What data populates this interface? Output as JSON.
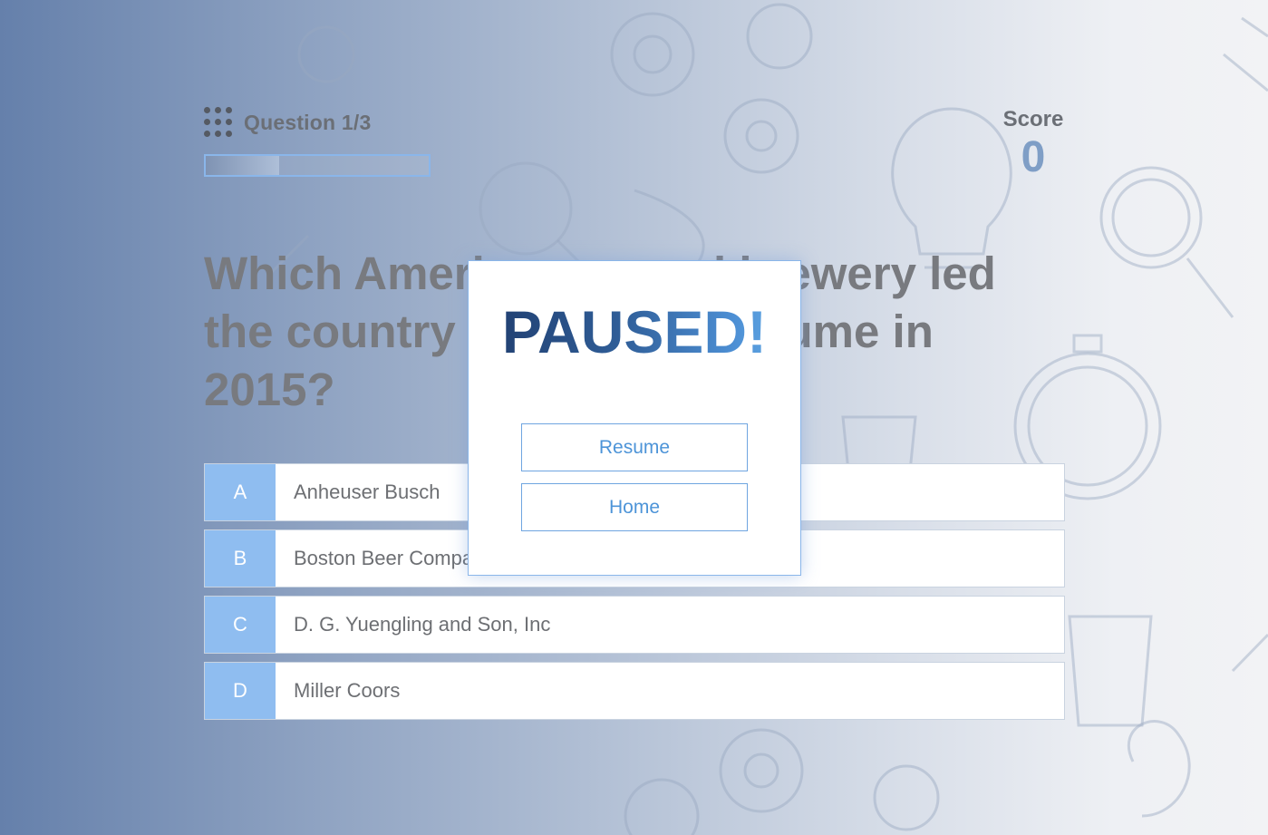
{
  "header": {
    "question_label": "Question 1/3",
    "progress": 0.33,
    "score_label": "Score",
    "score_value": "0"
  },
  "question": {
    "text": "Which American-owned brewery led the country in sales by volume in 2015?"
  },
  "answers": [
    {
      "letter": "A",
      "text": "Anheuser Busch"
    },
    {
      "letter": "B",
      "text": "Boston Beer Company"
    },
    {
      "letter": "C",
      "text": "D. G. Yuengling and Son, Inc"
    },
    {
      "letter": "D",
      "text": "Miller Coors"
    }
  ],
  "pause_modal": {
    "title": "PAUSED!",
    "resume_label": "Resume",
    "home_label": "Home"
  },
  "colors": {
    "accent": "#8fbdf0",
    "title_gradient_start": "#1e3a6a",
    "title_gradient_end": "#6ab3ec",
    "button_text": "#4d94d8"
  },
  "icons": [
    "menu-dots-icon",
    "background-doodles"
  ]
}
